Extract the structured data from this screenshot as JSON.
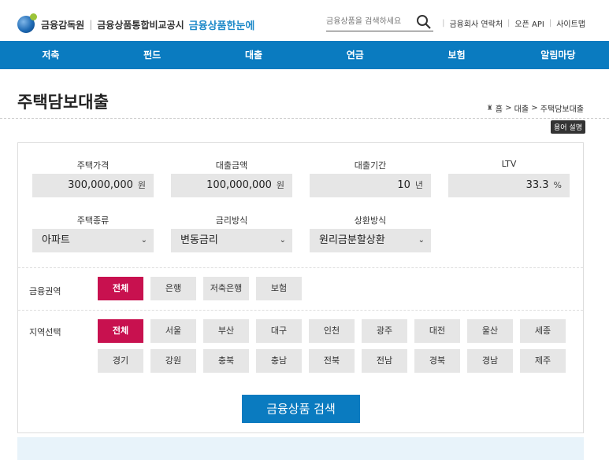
{
  "header": {
    "org": "금융감독원",
    "site_title": "금융상품통합비교공시",
    "brand": "금융상품한눈에",
    "search_placeholder": "금융상품을 검색하세요",
    "util_links": [
      "금융회사 연락처",
      "오픈 API",
      "사이트맵"
    ]
  },
  "nav": [
    "저축",
    "펀드",
    "대출",
    "연금",
    "보험",
    "알림마당"
  ],
  "page": {
    "title": "주택담보대출",
    "breadcrumb": [
      "홈",
      "대출",
      "주택담보대출"
    ],
    "term_button": "용어 설명"
  },
  "form": {
    "fields": [
      {
        "label": "주택가격",
        "value": "300,000,000",
        "unit": "원"
      },
      {
        "label": "대출금액",
        "value": "100,000,000",
        "unit": "원"
      },
      {
        "label": "대출기간",
        "value": "10",
        "unit": "년"
      },
      {
        "label": "LTV",
        "value": "33.3",
        "unit": "%"
      }
    ],
    "selects": [
      {
        "label": "주택종류",
        "value": "아파트"
      },
      {
        "label": "금리방식",
        "value": "변동금리"
      },
      {
        "label": "상환방식",
        "value": "원리금분할상환"
      }
    ],
    "sector": {
      "label": "금융권역",
      "options": [
        "전체",
        "은행",
        "저축은행",
        "보험"
      ],
      "selected": "전체"
    },
    "region": {
      "label": "지역선택",
      "options_row1": [
        "전체",
        "서울",
        "부산",
        "대구",
        "인천",
        "광주",
        "대전",
        "울산",
        "세종"
      ],
      "options_row2": [
        "경기",
        "강원",
        "충북",
        "충남",
        "전북",
        "전남",
        "경북",
        "경남",
        "제주"
      ],
      "selected": "전체"
    },
    "submit_label": "금융상품 검색"
  },
  "colors": {
    "primary": "#0a7bc0",
    "active_chip": "#c8114f",
    "brand_text": "#1b88c8"
  }
}
